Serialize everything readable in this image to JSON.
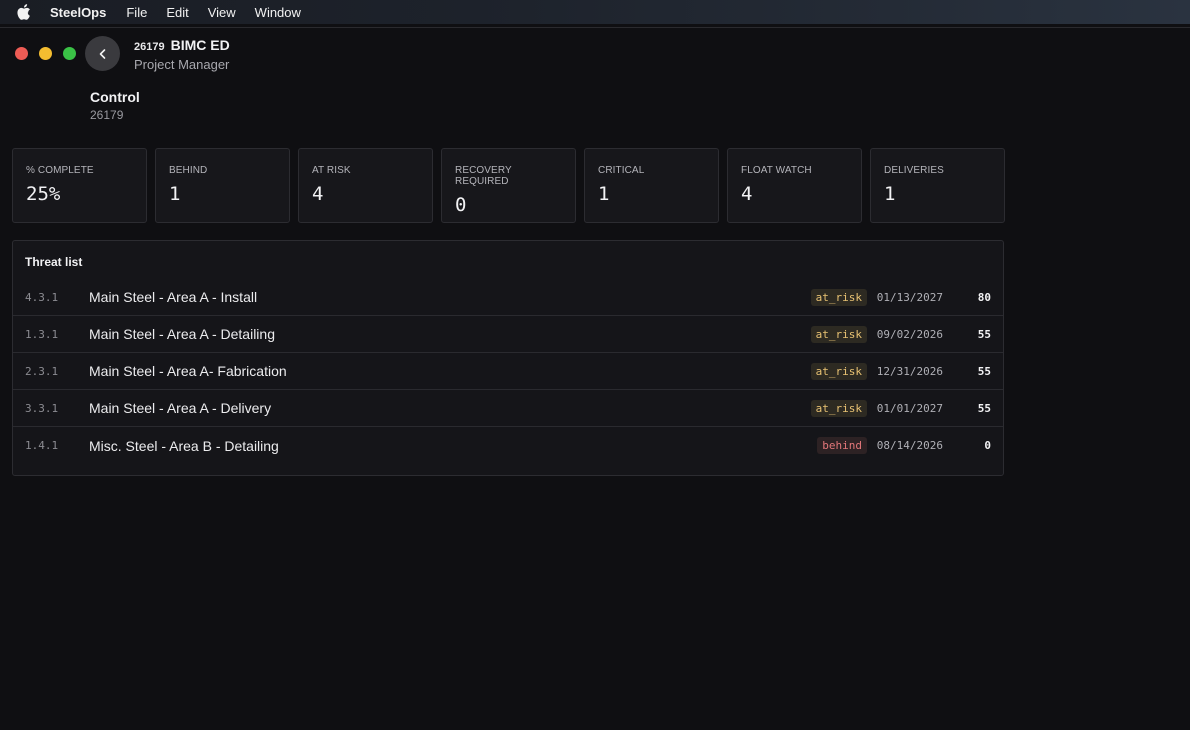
{
  "menubar": {
    "app_name": "SteelOps",
    "items": [
      "File",
      "Edit",
      "View",
      "Window"
    ]
  },
  "header": {
    "project_code": "26179",
    "project_title": "BIMC ED",
    "role": "Project Manager"
  },
  "section": {
    "title": "Control",
    "subtitle": "26179"
  },
  "stats": [
    {
      "label": "% COMPLETE",
      "value": "25%"
    },
    {
      "label": "BEHIND",
      "value": "1"
    },
    {
      "label": "AT RISK",
      "value": "4"
    },
    {
      "label": "RECOVERY REQUIRED",
      "value": "0"
    },
    {
      "label": "CRITICAL",
      "value": "1"
    },
    {
      "label": "FLOAT WATCH",
      "value": "4"
    },
    {
      "label": "DELIVERIES",
      "value": "1"
    }
  ],
  "threat_list": {
    "title": "Threat list",
    "rows": [
      {
        "code": "4.3.1",
        "name": "Main Steel - Area A - Install",
        "status": "at_risk",
        "date": "01/13/2027",
        "score": "80"
      },
      {
        "code": "1.3.1",
        "name": "Main Steel - Area A - Detailing",
        "status": "at_risk",
        "date": "09/02/2026",
        "score": "55"
      },
      {
        "code": "2.3.1",
        "name": "Main Steel - Area A- Fabrication",
        "status": "at_risk",
        "date": "12/31/2026",
        "score": "55"
      },
      {
        "code": "3.3.1",
        "name": "Main Steel - Area A - Delivery",
        "status": "at_risk",
        "date": "01/01/2027",
        "score": "55"
      },
      {
        "code": "1.4.1",
        "name": "Misc. Steel - Area B - Detailing",
        "status": "behind",
        "date": "08/14/2026",
        "score": "0"
      }
    ]
  },
  "colors": {
    "at_risk": "#e8c273",
    "behind": "#e3777a",
    "close": "#ee5c55",
    "minimize": "#f4bd30",
    "maximize": "#3ac246"
  }
}
